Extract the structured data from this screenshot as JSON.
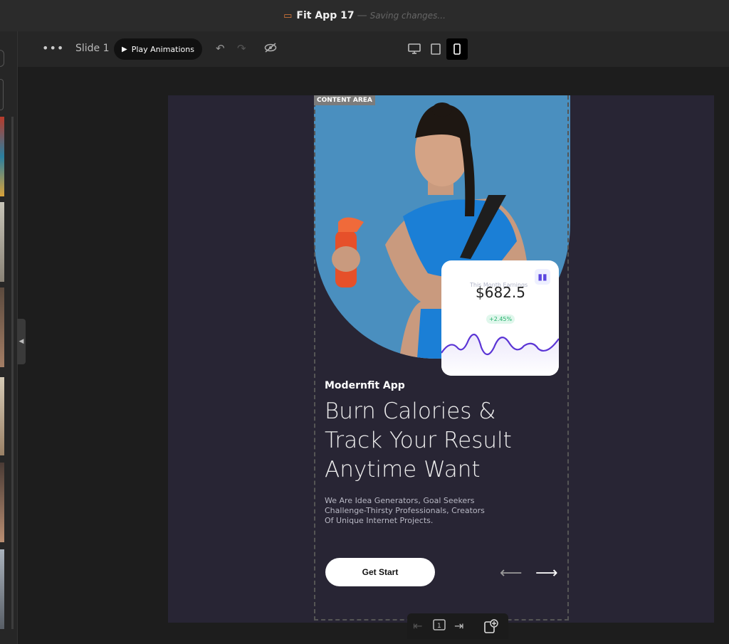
{
  "window": {
    "title": "Fit App 17",
    "separator": "—",
    "status": "Saving changes..."
  },
  "toolbar": {
    "more_label": "•••",
    "slide_label": "Slide 1",
    "play_label": "Play Animations"
  },
  "canvas": {
    "content_area_label": "CONTENT AREA",
    "card": {
      "label": "This Month Earnings",
      "amount": "$682.5",
      "change": "+2.45%"
    },
    "app_name": "Modernfit App",
    "headline": "Burn Calories & Track Your Result Anytime Want",
    "description": "We Are Idea Generators, Goal Seekers\n Challenge-Thirsty Professionals, Creators\nOf Unique Internet Projects.",
    "cta_label": "Get Start"
  },
  "colors": {
    "hero_blue": "#4a8fbf",
    "canvas_bg": "#282534",
    "chart_line": "#5b35d5",
    "accent_orange": "#e07b39"
  }
}
